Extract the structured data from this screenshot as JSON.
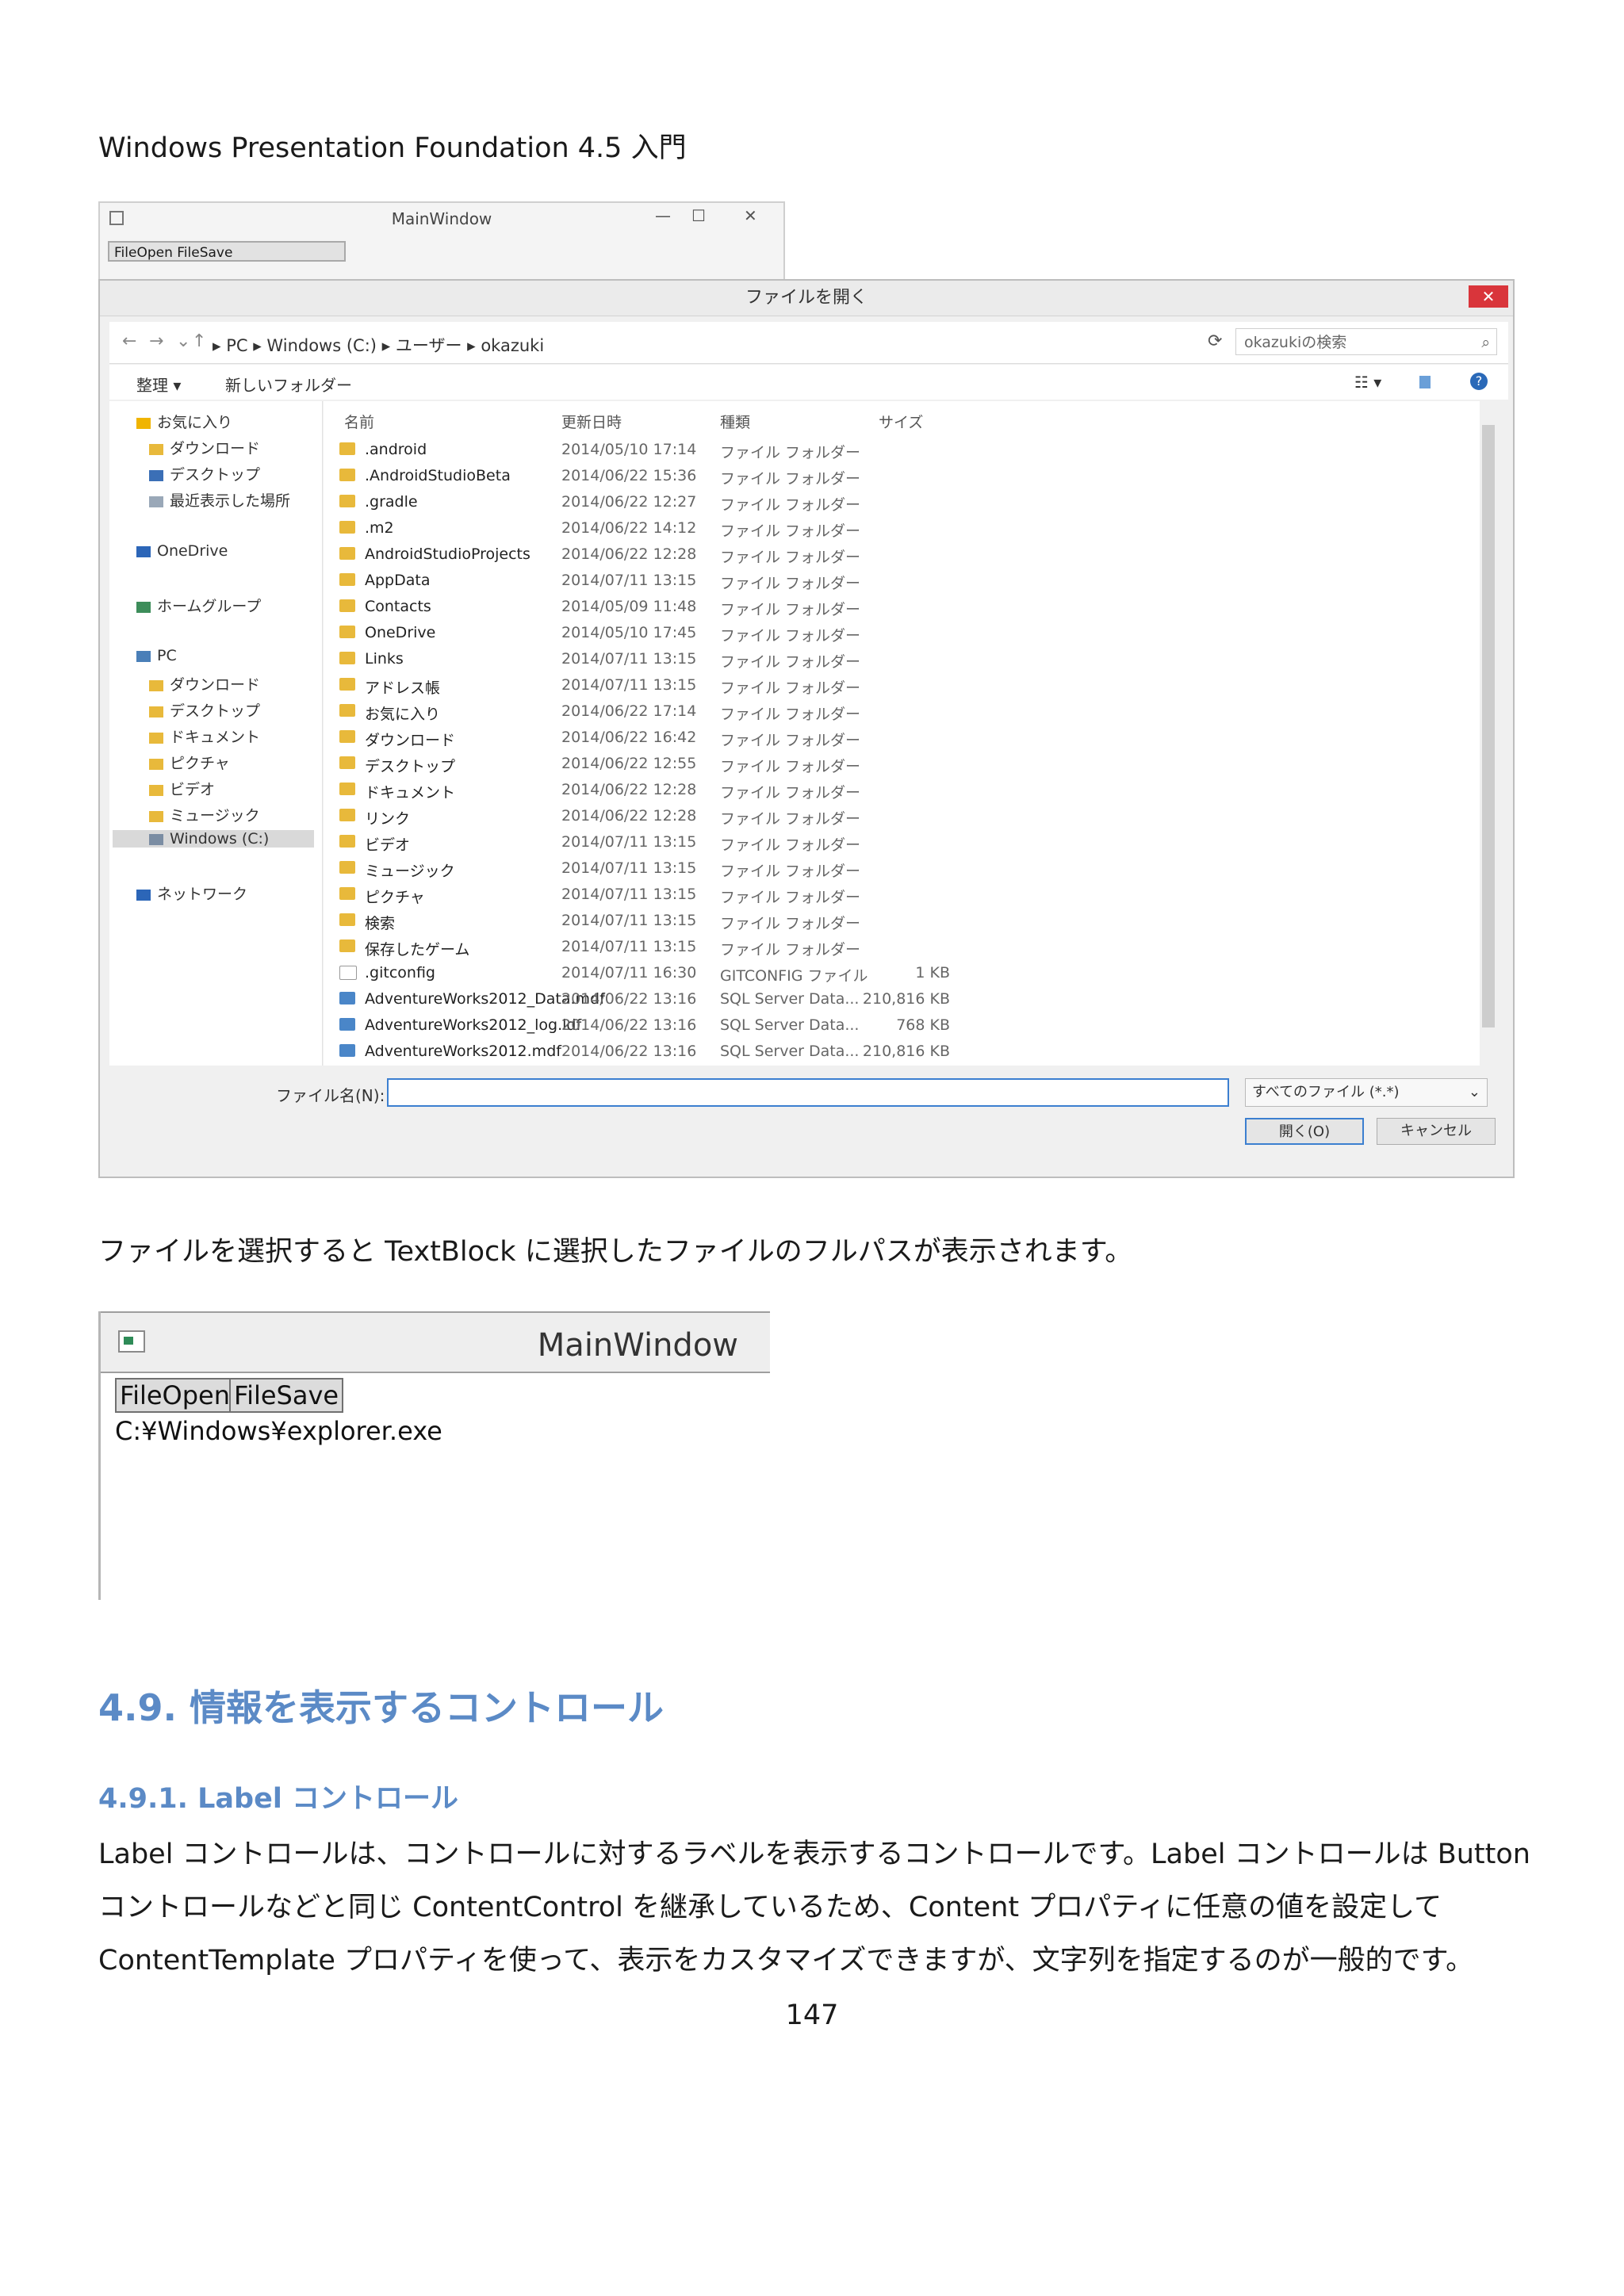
{
  "header": {
    "running_title": "Windows Presentation Foundation 4.5  入門"
  },
  "screenshot1": {
    "background_window": {
      "title": "MainWindow",
      "controls": [
        "—",
        "☐",
        "✕"
      ],
      "buttons": "FileOpen FileSave"
    },
    "dialog": {
      "title": "ファイルを開く",
      "close": "✕",
      "nav_buttons": [
        "←",
        "→",
        "⌄",
        "↑"
      ],
      "breadcrumb": "▸ PC ▸ Windows (C:) ▸ ユーザー ▸ okazuki",
      "refresh": "⟳",
      "search_placeholder": "okazukiの検索",
      "toolbar": {
        "organize": "整理 ▾",
        "new_folder": "新しいフォルダー",
        "views": "☷ ▾",
        "help": "?"
      },
      "nav_pane": [
        "お気に入り",
        "ダウンロード",
        "デスクトップ",
        "最近表示した場所",
        "OneDrive",
        "ホームグループ",
        "PC",
        "ダウンロード",
        "デスクトップ",
        "ドキュメント",
        "ピクチャ",
        "ビデオ",
        "ミュージック",
        "Windows (C:)",
        "ネットワーク"
      ],
      "columns": [
        "名前",
        "更新日時",
        "種類",
        "サイズ"
      ],
      "files": [
        {
          "name": ".android",
          "date": "2014/05/10 17:14",
          "type": "ファイル フォルダー",
          "size": ""
        },
        {
          "name": ".AndroidStudioBeta",
          "date": "2014/06/22 15:36",
          "type": "ファイル フォルダー",
          "size": ""
        },
        {
          "name": ".gradle",
          "date": "2014/06/22 12:27",
          "type": "ファイル フォルダー",
          "size": ""
        },
        {
          "name": ".m2",
          "date": "2014/06/22 14:12",
          "type": "ファイル フォルダー",
          "size": ""
        },
        {
          "name": "AndroidStudioProjects",
          "date": "2014/06/22 12:28",
          "type": "ファイル フォルダー",
          "size": ""
        },
        {
          "name": "AppData",
          "date": "2014/07/11 13:15",
          "type": "ファイル フォルダー",
          "size": ""
        },
        {
          "name": "Contacts",
          "date": "2014/05/09 11:48",
          "type": "ファイル フォルダー",
          "size": ""
        },
        {
          "name": "OneDrive",
          "date": "2014/05/10 17:45",
          "type": "ファイル フォルダー",
          "size": ""
        },
        {
          "name": "Links",
          "date": "2014/07/11 13:15",
          "type": "ファイル フォルダー",
          "size": ""
        },
        {
          "name": "アドレス帳",
          "date": "2014/07/11 13:15",
          "type": "ファイル フォルダー",
          "size": ""
        },
        {
          "name": "お気に入り",
          "date": "2014/06/22 17:14",
          "type": "ファイル フォルダー",
          "size": ""
        },
        {
          "name": "ダウンロード",
          "date": "2014/06/22 16:42",
          "type": "ファイル フォルダー",
          "size": ""
        },
        {
          "name": "デスクトップ",
          "date": "2014/06/22 12:55",
          "type": "ファイル フォルダー",
          "size": ""
        },
        {
          "name": "ドキュメント",
          "date": "2014/06/22 12:28",
          "type": "ファイル フォルダー",
          "size": ""
        },
        {
          "name": "リンク",
          "date": "2014/06/22 12:28",
          "type": "ファイル フォルダー",
          "size": ""
        },
        {
          "name": "ビデオ",
          "date": "2014/07/11 13:15",
          "type": "ファイル フォルダー",
          "size": ""
        },
        {
          "name": "ミュージック",
          "date": "2014/07/11 13:15",
          "type": "ファイル フォルダー",
          "size": ""
        },
        {
          "name": "ピクチャ",
          "date": "2014/07/11 13:15",
          "type": "ファイル フォルダー",
          "size": ""
        },
        {
          "name": "検索",
          "date": "2014/07/11 13:15",
          "type": "ファイル フォルダー",
          "size": ""
        },
        {
          "name": "保存したゲーム",
          "date": "2014/07/11 13:15",
          "type": "ファイル フォルダー",
          "size": ""
        },
        {
          "name": ".gitconfig",
          "date": "2014/07/11 16:30",
          "type": "GITCONFIG ファイル",
          "size": "1 KB"
        },
        {
          "name": "AdventureWorks2012_Data.mdf",
          "date": "2014/06/22 13:16",
          "type": "SQL Server Data...",
          "size": "210,816 KB"
        },
        {
          "name": "AdventureWorks2012_log.ldf",
          "date": "2014/06/22 13:16",
          "type": "SQL Server Data...",
          "size": "768 KB"
        },
        {
          "name": "AdventureWorks2012.mdf",
          "date": "2014/06/22 13:16",
          "type": "SQL Server Data...",
          "size": "210,816 KB"
        }
      ],
      "filename_label": "ファイル名(N):",
      "filetype": "すべてのファイル (*.*)",
      "open_button": "開く(O)",
      "cancel_button": "キャンセル"
    }
  },
  "body_text": {
    "caption1": "ファイルを選択すると TextBlock に選択したファイルのフルパスが表示されます。"
  },
  "screenshot2": {
    "title": "MainWindow",
    "btn_open": "FileOpen",
    "btn_save": "FileSave",
    "path": "C:¥Windows¥explorer.exe"
  },
  "section": {
    "heading": "4.9. 情報を表示するコントロール",
    "subheading": "4.9.1.  Label コントロール",
    "lines": [
      "Label コントロールは、コントロールに対するラベルを表示するコントロールです。Label コントロールは Button",
      "コントロールなどと同じ ContentControl を継承しているため、Content プロパティに任意の値を設定して",
      "ContentTemplate プロパティを使って、表示をカスタマイズできますが、文字列を指定するのが一般的です。"
    ]
  },
  "page_number": "147"
}
